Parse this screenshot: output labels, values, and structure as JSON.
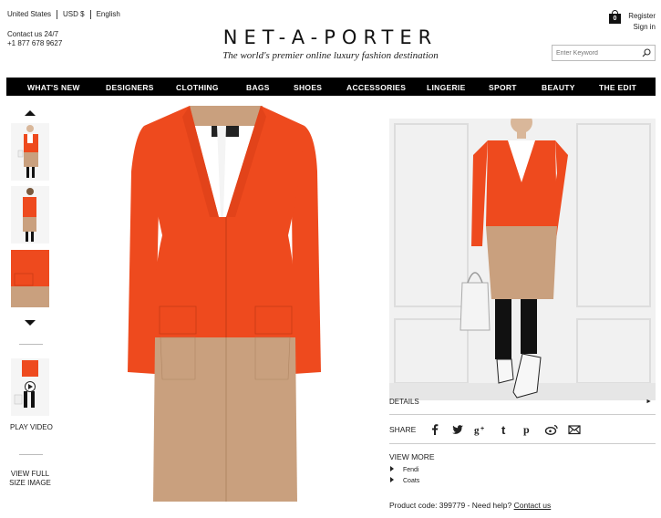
{
  "header": {
    "country": "United States",
    "currency": "USD $",
    "language": "English",
    "contact_line1": "Contact us 24/7",
    "contact_line2": "+1 877 678 9627",
    "logo": "NET-A-PORTER",
    "tagline": "The world's premier online luxury fashion destination",
    "bag_count": "0",
    "register": "Register",
    "sign_in": "Sign in",
    "search_placeholder": "Enter Keyword"
  },
  "nav": {
    "items": [
      "WHAT'S NEW",
      "DESIGNERS",
      "CLOTHING",
      "BAGS",
      "SHOES",
      "ACCESSORIES",
      "LINGERIE",
      "SPORT",
      "BEAUTY",
      "THE EDIT"
    ]
  },
  "gallery": {
    "play_video": "PLAY VIDEO",
    "view_full_line1": "VIEW FULL",
    "view_full_line2": "SIZE IMAGE"
  },
  "product": {
    "details_label": "DETAILS",
    "share_label": "SHARE",
    "social_icons": [
      "facebook-icon",
      "twitter-icon",
      "google-plus-icon",
      "tumblr-icon",
      "pinterest-icon",
      "weibo-icon",
      "email-icon"
    ],
    "view_more_label": "VIEW MORE",
    "view_more_items": [
      "Fendi",
      "Coats"
    ],
    "code_text": "Product code: 399779 - Need help?",
    "contact_link": "Contact us"
  },
  "colors": {
    "coat_orange": "#ee4a1e",
    "coat_tan": "#c9a07e",
    "nav_bg": "#000000"
  }
}
